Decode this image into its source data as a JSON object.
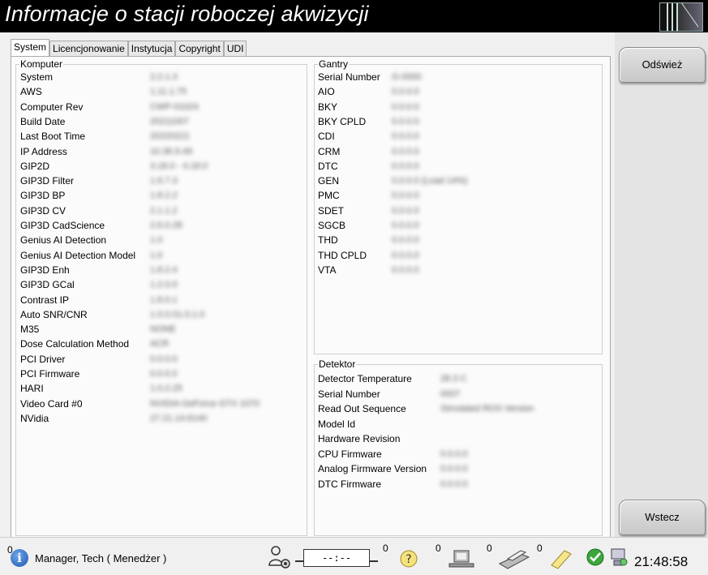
{
  "window": {
    "title": "Informacje o stacji roboczej akwizycji"
  },
  "tabs": [
    "System",
    "Licencjonowanie",
    "Instytucja",
    "Copyright",
    "UDI"
  ],
  "computer": {
    "legend": "Komputer",
    "rows": [
      {
        "label": "System",
        "value": "2.2.1.3"
      },
      {
        "label": "AWS",
        "value": "1.11.1.75"
      },
      {
        "label": "Computer Rev",
        "value": "CWP-01024"
      },
      {
        "label": "Build Date",
        "value": "20211007"
      },
      {
        "label": "Last Boot Time",
        "value": "20220221"
      },
      {
        "label": "IP Address",
        "value": "10.36.9.49"
      },
      {
        "label": "GIP2D",
        "value": "3.18.0 - 4.18.0"
      },
      {
        "label": "GIP3D Filter",
        "value": "1.6.7.3"
      },
      {
        "label": "GIP3D BP",
        "value": "1.8.2.2"
      },
      {
        "label": "GIP3D CV",
        "value": "2.1.1.2"
      },
      {
        "label": "GIP3D CadScience",
        "value": "2.6.0.28"
      },
      {
        "label": "Genius AI Detection",
        "value": "1.0"
      },
      {
        "label": "Genius AI Detection Model",
        "value": "1.0"
      },
      {
        "label": "GIP3D Enh",
        "value": "1.8.2.4"
      },
      {
        "label": "GIP3D GCal",
        "value": "1.2.0.0"
      },
      {
        "label": "Contrast IP",
        "value": "1.8.0.1"
      },
      {
        "label": "Auto SNR/CNR",
        "value": "1.0.0.01.0.1.0"
      },
      {
        "label": "M35",
        "value": "NONE"
      },
      {
        "label": "Dose Calculation Method",
        "value": "ACR"
      },
      {
        "label": "PCI Driver",
        "value": "0.0.0.0"
      },
      {
        "label": "PCI Firmware",
        "value": "0.0.0.0"
      },
      {
        "label": "HARI",
        "value": "1.0.2.25"
      },
      {
        "label": "Video Card #0",
        "value": "NVIDIA GeForce GTX 1070"
      },
      {
        "label": "NVidia",
        "value": "27.21.14.6140"
      }
    ]
  },
  "gantry": {
    "legend": "Gantry",
    "rows": [
      {
        "label": "Serial Number",
        "value": "G-0000"
      },
      {
        "label": "AIO",
        "value": "0.0.0.0"
      },
      {
        "label": "BKY",
        "value": "0.0.0.0"
      },
      {
        "label": "BKY CPLD",
        "value": "0.0.0.0"
      },
      {
        "label": "CDI",
        "value": "0.0.0.0"
      },
      {
        "label": "CRM",
        "value": "0.0.0.0"
      },
      {
        "label": "DTC",
        "value": "0.0.0.0"
      },
      {
        "label": "GEN",
        "value": "0.0.0.0   (Load 14%)"
      },
      {
        "label": "PMC",
        "value": "0.0.0.0"
      },
      {
        "label": "SDET",
        "value": "0.0.0.0"
      },
      {
        "label": "SGCB",
        "value": "0.0.0.0"
      },
      {
        "label": "THD",
        "value": "0.0.0.0"
      },
      {
        "label": "THD CPLD",
        "value": "0.0.0.0"
      },
      {
        "label": "VTA",
        "value": "0.0.0.0"
      }
    ]
  },
  "detector": {
    "legend": "Detektor",
    "rows": [
      {
        "label": "Detector Temperature",
        "value": "28.3 C"
      },
      {
        "label": "Serial Number",
        "value": "0007"
      },
      {
        "label": "Read Out Sequence",
        "value": "Simulated ROS Version"
      },
      {
        "label": "Model Id",
        "value": ""
      },
      {
        "label": "Hardware Revision",
        "value": ""
      },
      {
        "label": "CPU Firmware",
        "value": "0.0.0.0"
      },
      {
        "label": "Analog Firmware Version",
        "value": "0.0.0.0"
      },
      {
        "label": "DTC Firmware",
        "value": "0.0.0.0"
      }
    ]
  },
  "sidebar": {
    "refresh_label": "Odśwież",
    "back_label": "Wstecz"
  },
  "statusbar": {
    "left_count": "0",
    "user": "Manager, Tech ( Menedżer )",
    "timer": "--:--",
    "counts": [
      "0",
      "0",
      "0",
      "0"
    ],
    "clock": "21:48:58"
  }
}
